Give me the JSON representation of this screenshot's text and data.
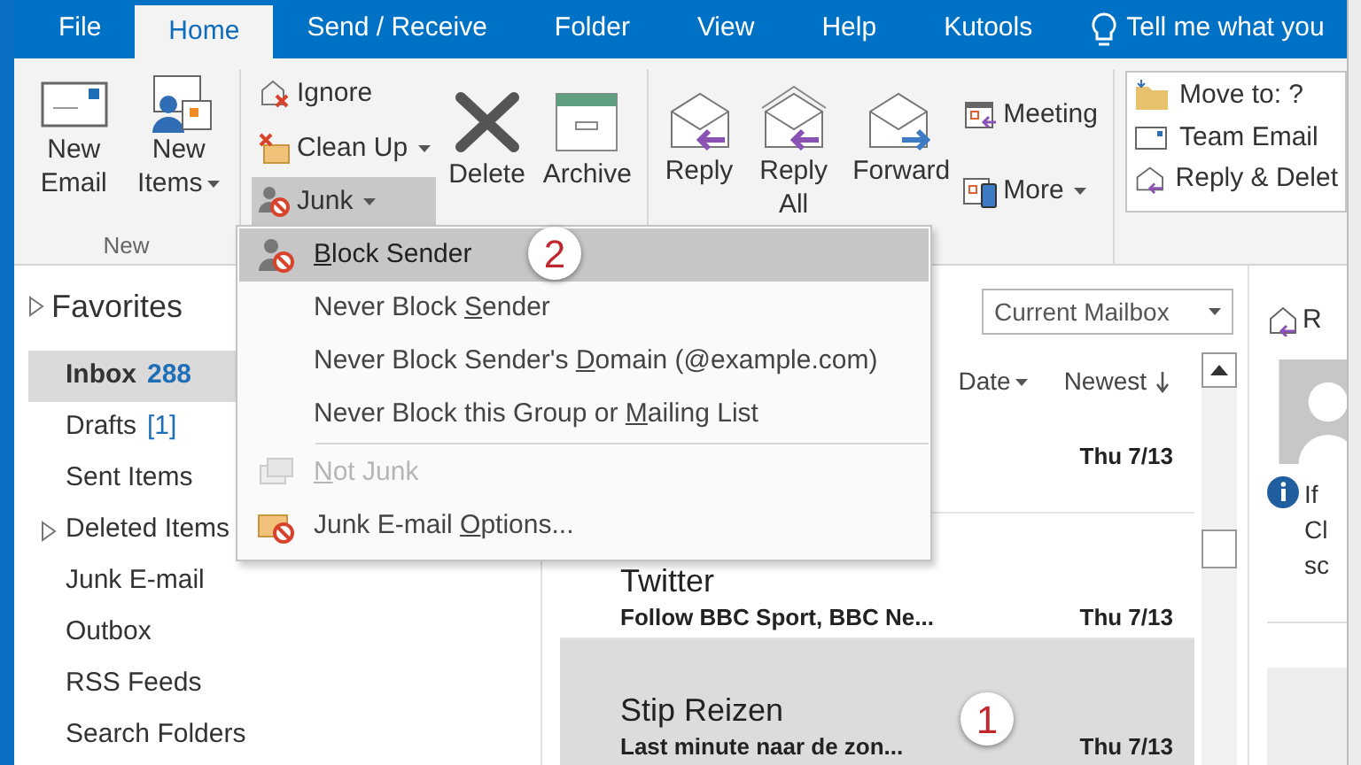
{
  "tabs": [
    {
      "label": "File",
      "selected": false
    },
    {
      "label": "Home",
      "selected": true
    },
    {
      "label": "Send / Receive",
      "selected": false
    },
    {
      "label": "Folder",
      "selected": false
    },
    {
      "label": "View",
      "selected": false
    },
    {
      "label": "Help",
      "selected": false
    },
    {
      "label": "Kutools",
      "selected": false
    }
  ],
  "tell_me": {
    "text": "Tell me what you"
  },
  "ribbon": {
    "new_group": {
      "label": "New",
      "buttons": [
        {
          "label": "New Email",
          "dropdown": false
        },
        {
          "label": "New Items",
          "dropdown": true
        }
      ]
    },
    "delete_group": {
      "small_buttons": [
        {
          "label": "Ignore",
          "dropdown": false,
          "pressed": false
        },
        {
          "label": "Clean Up",
          "dropdown": true,
          "pressed": false
        },
        {
          "label": "Junk",
          "dropdown": true,
          "pressed": true
        }
      ],
      "large_buttons": [
        {
          "label": "Delete"
        },
        {
          "label": "Archive"
        }
      ]
    },
    "respond_group": {
      "large_buttons": [
        {
          "label": "Reply"
        },
        {
          "label": "Reply All"
        },
        {
          "label": "Forward"
        }
      ],
      "small_buttons": [
        {
          "label": "Meeting",
          "dropdown": false
        },
        {
          "label": "More",
          "dropdown": true
        }
      ]
    },
    "quick_steps": [
      {
        "label": "Move to: ?"
      },
      {
        "label": "Team Email"
      },
      {
        "label": "Reply & Delet"
      }
    ]
  },
  "favorites": {
    "label": "Favorites",
    "expanded": false
  },
  "folders": [
    {
      "label": "Inbox",
      "count": "288",
      "selected": true,
      "unread": true,
      "expander": false
    },
    {
      "label": "Drafts",
      "count": "[1]",
      "selected": false,
      "unread": false,
      "expander": false
    },
    {
      "label": "Sent Items",
      "selected": false,
      "unread": false,
      "expander": false
    },
    {
      "label": "Deleted Items",
      "selected": false,
      "unread": false,
      "expander": true
    },
    {
      "label": "Junk E-mail",
      "selected": false,
      "unread": false,
      "expander": false
    },
    {
      "label": "Outbox",
      "selected": false,
      "unread": false,
      "expander": false
    },
    {
      "label": "RSS Feeds",
      "selected": false,
      "unread": false,
      "expander": false
    },
    {
      "label": "Search Folders",
      "selected": false,
      "unread": false,
      "expander": false
    }
  ],
  "message_list": {
    "search": {
      "scope": "Current Mailbox"
    },
    "sort": {
      "by": "Date",
      "order": "Newest"
    },
    "messages": [
      {
        "date": "Thu 7/13",
        "selected": false
      },
      {
        "sender": "Twitter",
        "preview": "Follow BBC Sport, BBC Ne...",
        "date": "Thu 7/13",
        "selected": false
      },
      {
        "sender": "Stip Reizen",
        "preview": "Last minute naar de zon...",
        "date": "Thu 7/13",
        "selected": true
      }
    ]
  },
  "reading_pane": {
    "reply_label": "R",
    "info_lines": [
      "If",
      "Cl",
      "sc"
    ]
  },
  "junk_menu": [
    {
      "kind": "item",
      "access_key": "B",
      "after": "lock Sender",
      "highlighted": true,
      "disabled": false
    },
    {
      "kind": "item",
      "before": "Never Block ",
      "access_key": "S",
      "after": "ender",
      "highlighted": false,
      "disabled": false
    },
    {
      "kind": "item",
      "before": "Never Block Sender's ",
      "access_key": "D",
      "after": "omain (@example.com)",
      "highlighted": false,
      "disabled": false
    },
    {
      "kind": "item",
      "before": "Never Block this Group or ",
      "access_key": "M",
      "after": "ailing List",
      "highlighted": false,
      "disabled": false
    },
    {
      "kind": "separator"
    },
    {
      "kind": "item",
      "access_key": "N",
      "after": "ot Junk",
      "highlighted": false,
      "disabled": true
    },
    {
      "kind": "item",
      "before": "Junk E-mail ",
      "access_key": "O",
      "after": "ptions...",
      "highlighted": false,
      "disabled": false
    }
  ],
  "callouts": [
    {
      "text": "2"
    },
    {
      "text": "1"
    }
  ]
}
